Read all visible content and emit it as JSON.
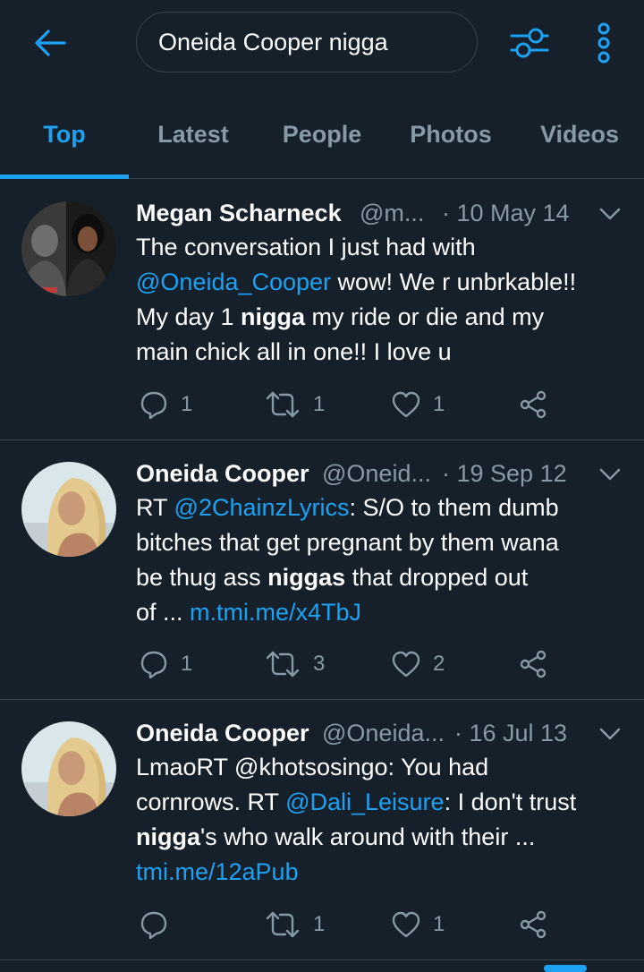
{
  "search": {
    "query": "Oneida Cooper nigga"
  },
  "icons": {
    "back": "arrow-left-icon",
    "filter": "sliders-icon",
    "more": "more-vertical-icon",
    "reply": "reply-icon",
    "retweet": "retweet-icon",
    "like": "heart-icon",
    "share": "share-icon",
    "caret": "chevron-down-icon"
  },
  "colors": {
    "accent": "#1da1f2",
    "background": "#15202b",
    "muted": "#8899a6",
    "divider": "#38444d"
  },
  "tabs": [
    {
      "label": "Top",
      "active": true
    },
    {
      "label": "Latest",
      "active": false
    },
    {
      "label": "People",
      "active": false
    },
    {
      "label": "Photos",
      "active": false
    },
    {
      "label": "Videos",
      "active": false
    }
  ],
  "tweets": [
    {
      "name": "Megan Scharneck",
      "handle": "@m...",
      "date": "· 10 May 14",
      "lines": [
        [
          {
            "t": "The conversation I just had with"
          }
        ],
        [
          {
            "t": "@Oneida_Cooper",
            "s": "link"
          },
          {
            "t": " wow! We r unbrkable!!"
          }
        ],
        [
          {
            "t": "My day 1 "
          },
          {
            "t": "nigga",
            "s": "bold"
          },
          {
            "t": " my ride or die and my"
          }
        ],
        [
          {
            "t": "main chick all in one!! I love u"
          }
        ]
      ],
      "reply_count": "1",
      "retweet_count": "1",
      "like_count": "1"
    },
    {
      "name": "Oneida Cooper",
      "handle": "@Oneid...",
      "date": "· 19 Sep 12",
      "lines": [
        [
          {
            "t": "RT "
          },
          {
            "t": "@2ChainzLyrics",
            "s": "link"
          },
          {
            "t": ": S/O to them dumb"
          }
        ],
        [
          {
            "t": "bitches that get pregnant by them wana"
          }
        ],
        [
          {
            "t": "be thug ass "
          },
          {
            "t": "niggas",
            "s": "bold"
          },
          {
            "t": " that dropped out"
          }
        ],
        [
          {
            "t": "of ... "
          },
          {
            "t": "m.tmi.me/x4TbJ",
            "s": "link"
          }
        ]
      ],
      "reply_count": "1",
      "retweet_count": "3",
      "like_count": "2"
    },
    {
      "name": "Oneida Cooper",
      "handle": "@Oneida...",
      "date": "· 16 Jul 13",
      "lines": [
        [
          {
            "t": "LmaoRT @khotsosingo: You had"
          }
        ],
        [
          {
            "t": "cornrows. RT "
          },
          {
            "t": "@Dali_Leisure",
            "s": "link"
          },
          {
            "t": ": I don't trust"
          }
        ],
        [
          {
            "t": "nigga",
            "s": "bold"
          },
          {
            "t": "'s who walk around with their ..."
          }
        ],
        [
          {
            "t": "tmi.me/12aPub",
            "s": "link"
          }
        ]
      ],
      "reply_count": "",
      "retweet_count": "1",
      "like_count": "1"
    }
  ]
}
